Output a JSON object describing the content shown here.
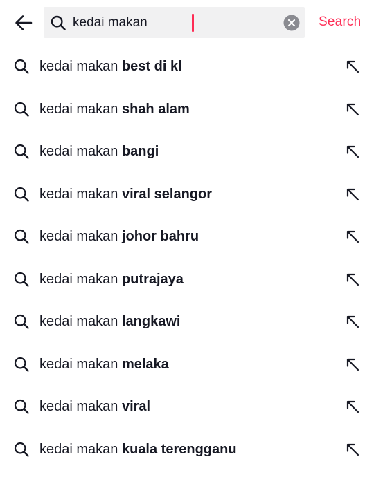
{
  "header": {
    "back_icon": "arrow-left-icon",
    "search_field": {
      "value": "kedai makan",
      "icon": "search-icon",
      "clear_icon": "clear-circle-icon"
    },
    "search_button_label": "Search"
  },
  "suggestions": [
    {
      "query": "kedai makan",
      "completion": "best di kl"
    },
    {
      "query": "kedai makan",
      "completion": "shah alam"
    },
    {
      "query": "kedai makan",
      "completion": "bangi"
    },
    {
      "query": "kedai makan",
      "completion": "viral selangor"
    },
    {
      "query": "kedai makan",
      "completion": "johor bahru"
    },
    {
      "query": "kedai makan",
      "completion": "putrajaya"
    },
    {
      "query": "kedai makan",
      "completion": "langkawi"
    },
    {
      "query": "kedai makan",
      "completion": "melaka"
    },
    {
      "query": "kedai makan",
      "completion": "viral"
    },
    {
      "query": "kedai makan",
      "completion": "kuala terengganu"
    }
  ],
  "colors": {
    "accent": "#fe2c55",
    "text": "#161823",
    "field_bg": "#f1f1f2"
  }
}
